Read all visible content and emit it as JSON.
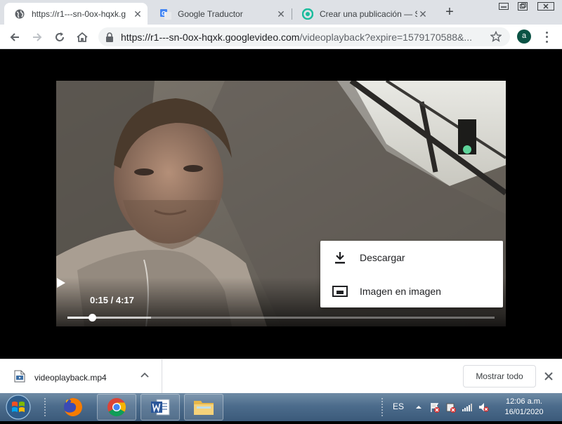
{
  "browser": {
    "tabs": [
      {
        "title": "https://r1---sn-0ox-hqxk.g",
        "icon": "globe-icon",
        "active": true
      },
      {
        "title": "Google Traductor",
        "icon": "google-translate-icon",
        "active": false
      },
      {
        "title": "Crear una publicación — S",
        "icon": "site-logo-icon",
        "active": false
      }
    ],
    "url_host": "https://r1---sn-0ox-hqxk.googlevideo.com",
    "url_path": "/videoplayback?expire=1579170588&...",
    "profile_initial": "a"
  },
  "video": {
    "current_time": "0:15",
    "duration": "4:17",
    "time_display": "0:15 / 4:17",
    "played_fraction": 0.058,
    "buffered_fraction": 0.195
  },
  "context_menu": {
    "items": [
      {
        "label": "Descargar",
        "icon": "download-icon"
      },
      {
        "label": "Imagen en imagen",
        "icon": "picture-in-picture-icon"
      }
    ]
  },
  "download_shelf": {
    "file_name": "videoplayback.mp4",
    "show_all_label": "Mostrar todo"
  },
  "taskbar": {
    "apps": [
      "firefox-icon",
      "chrome-icon",
      "word-icon",
      "file-explorer-icon"
    ],
    "language": "ES",
    "time": "12:06 a.m.",
    "date": "16/01/2020"
  },
  "colors": {
    "tabstrip": "#dee1e6",
    "avatar": "#0b5345",
    "taskbar": "#4c6c8c"
  }
}
